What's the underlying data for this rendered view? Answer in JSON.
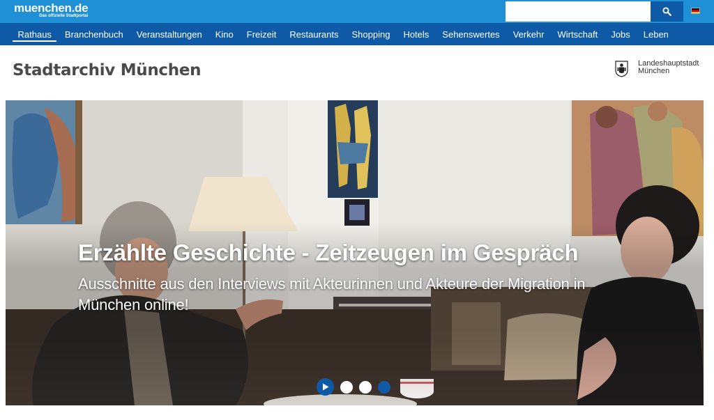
{
  "header": {
    "logo_main": "muenchen.de",
    "logo_sub": "Das offizielle Stadtportal",
    "search": {
      "placeholder": "",
      "value": ""
    },
    "search_icon": "search-icon",
    "language_icon": "german-flag-icon",
    "colors": {
      "topbar": "#1f8fd6",
      "navbar": "#0e5aa7"
    }
  },
  "nav": {
    "items": [
      {
        "label": "Rathaus"
      },
      {
        "label": "Branchenbuch"
      },
      {
        "label": "Veranstaltungen"
      },
      {
        "label": "Kino"
      },
      {
        "label": "Freizeit"
      },
      {
        "label": "Restaurants"
      },
      {
        "label": "Shopping"
      },
      {
        "label": "Hotels"
      },
      {
        "label": "Sehenswertes"
      },
      {
        "label": "Verkehr"
      },
      {
        "label": "Wirtschaft"
      },
      {
        "label": "Jobs"
      },
      {
        "label": "Leben"
      }
    ],
    "active_item": "Rathaus"
  },
  "page": {
    "title": "Stadtarchiv München",
    "city_logo": {
      "line1": "Landeshauptstadt",
      "line2": "München",
      "icon": "munich-crest-icon"
    }
  },
  "hero": {
    "title": "Erzählte Geschichte - Zeitzeugen im Gespräch",
    "subtitle": "Ausschnitte aus den Interviews mit Akteurinnen und Akteure der Migration in München online!",
    "controls": {
      "play_icon": "play-icon",
      "slide_count": 3,
      "active_slide": 3
    }
  }
}
